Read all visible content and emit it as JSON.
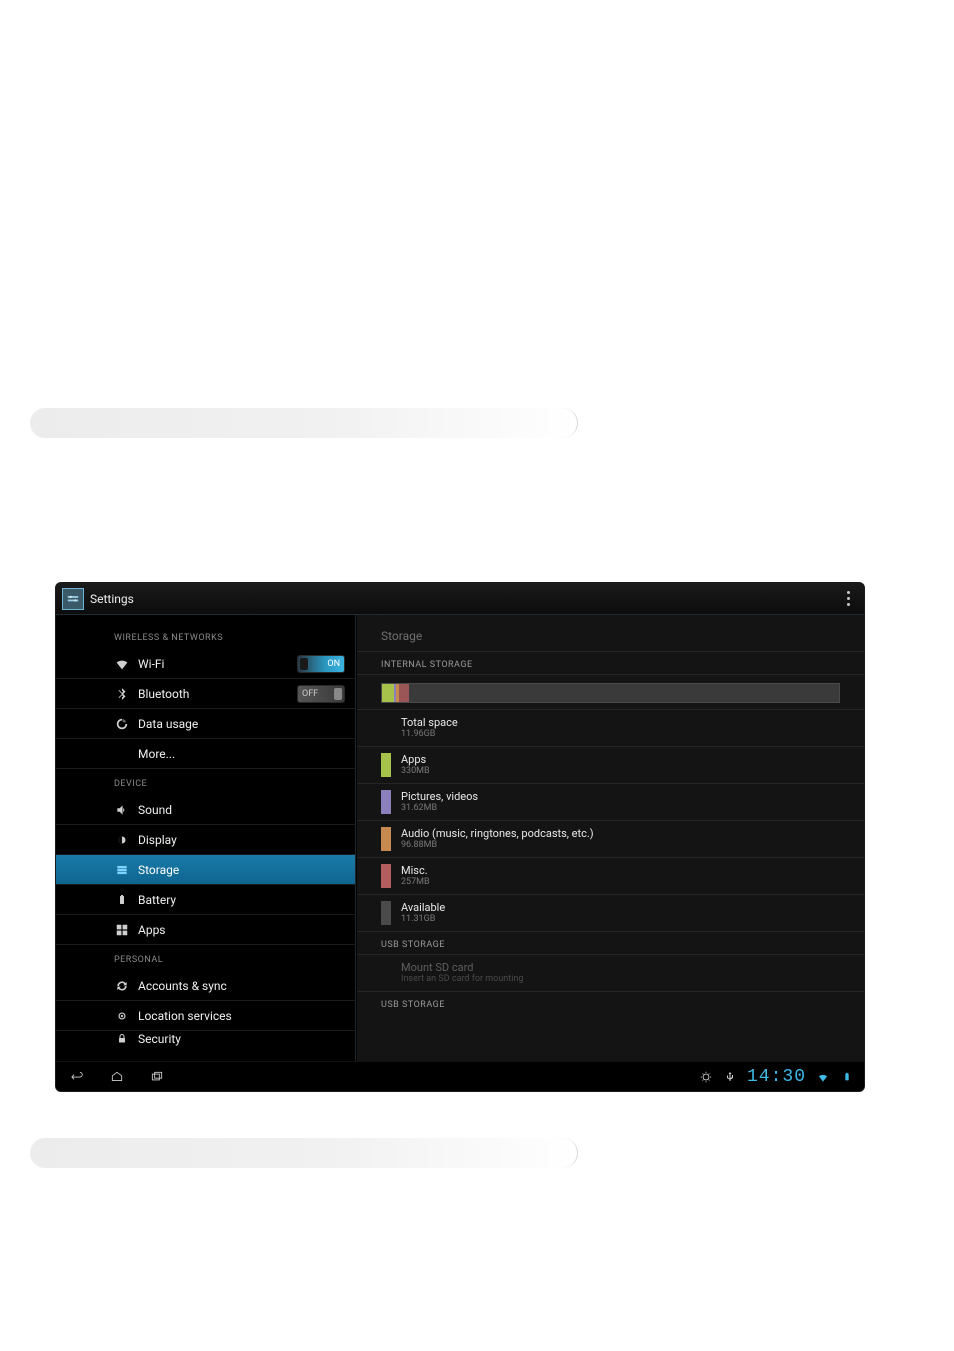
{
  "topbar": {
    "title": "Settings"
  },
  "left": {
    "section_wireless": "WIRELESS & NETWORKS",
    "wifi": {
      "label": "Wi-Fi",
      "toggle": "ON"
    },
    "bluetooth": {
      "label": "Bluetooth",
      "toggle": "OFF"
    },
    "data_usage": "Data usage",
    "more": "More...",
    "section_device": "DEVICE",
    "sound": "Sound",
    "display": "Display",
    "storage": "Storage",
    "battery": "Battery",
    "apps": "Apps",
    "section_personal": "PERSONAL",
    "accounts": "Accounts & sync",
    "location": "Location services",
    "security": "Security"
  },
  "right": {
    "title": "Storage",
    "sub_internal": "INTERNAL STORAGE",
    "total": {
      "t": "Total space",
      "s": "11.96GB"
    },
    "apps": {
      "t": "Apps",
      "s": "330MB"
    },
    "pics": {
      "t": "Pictures, videos",
      "s": "31.62MB"
    },
    "audio": {
      "t": "Audio (music, ringtones, podcasts, etc.)",
      "s": "96.88MB"
    },
    "misc": {
      "t": "Misc.",
      "s": "257MB"
    },
    "avail": {
      "t": "Available",
      "s": "11.31GB"
    },
    "sub_usb1": "USB STORAGE",
    "mount": {
      "t": "Mount SD card",
      "s": "Insert an SD card for mounting"
    },
    "sub_usb2": "USB STORAGE"
  },
  "statusbar": {
    "time": "14:30"
  }
}
